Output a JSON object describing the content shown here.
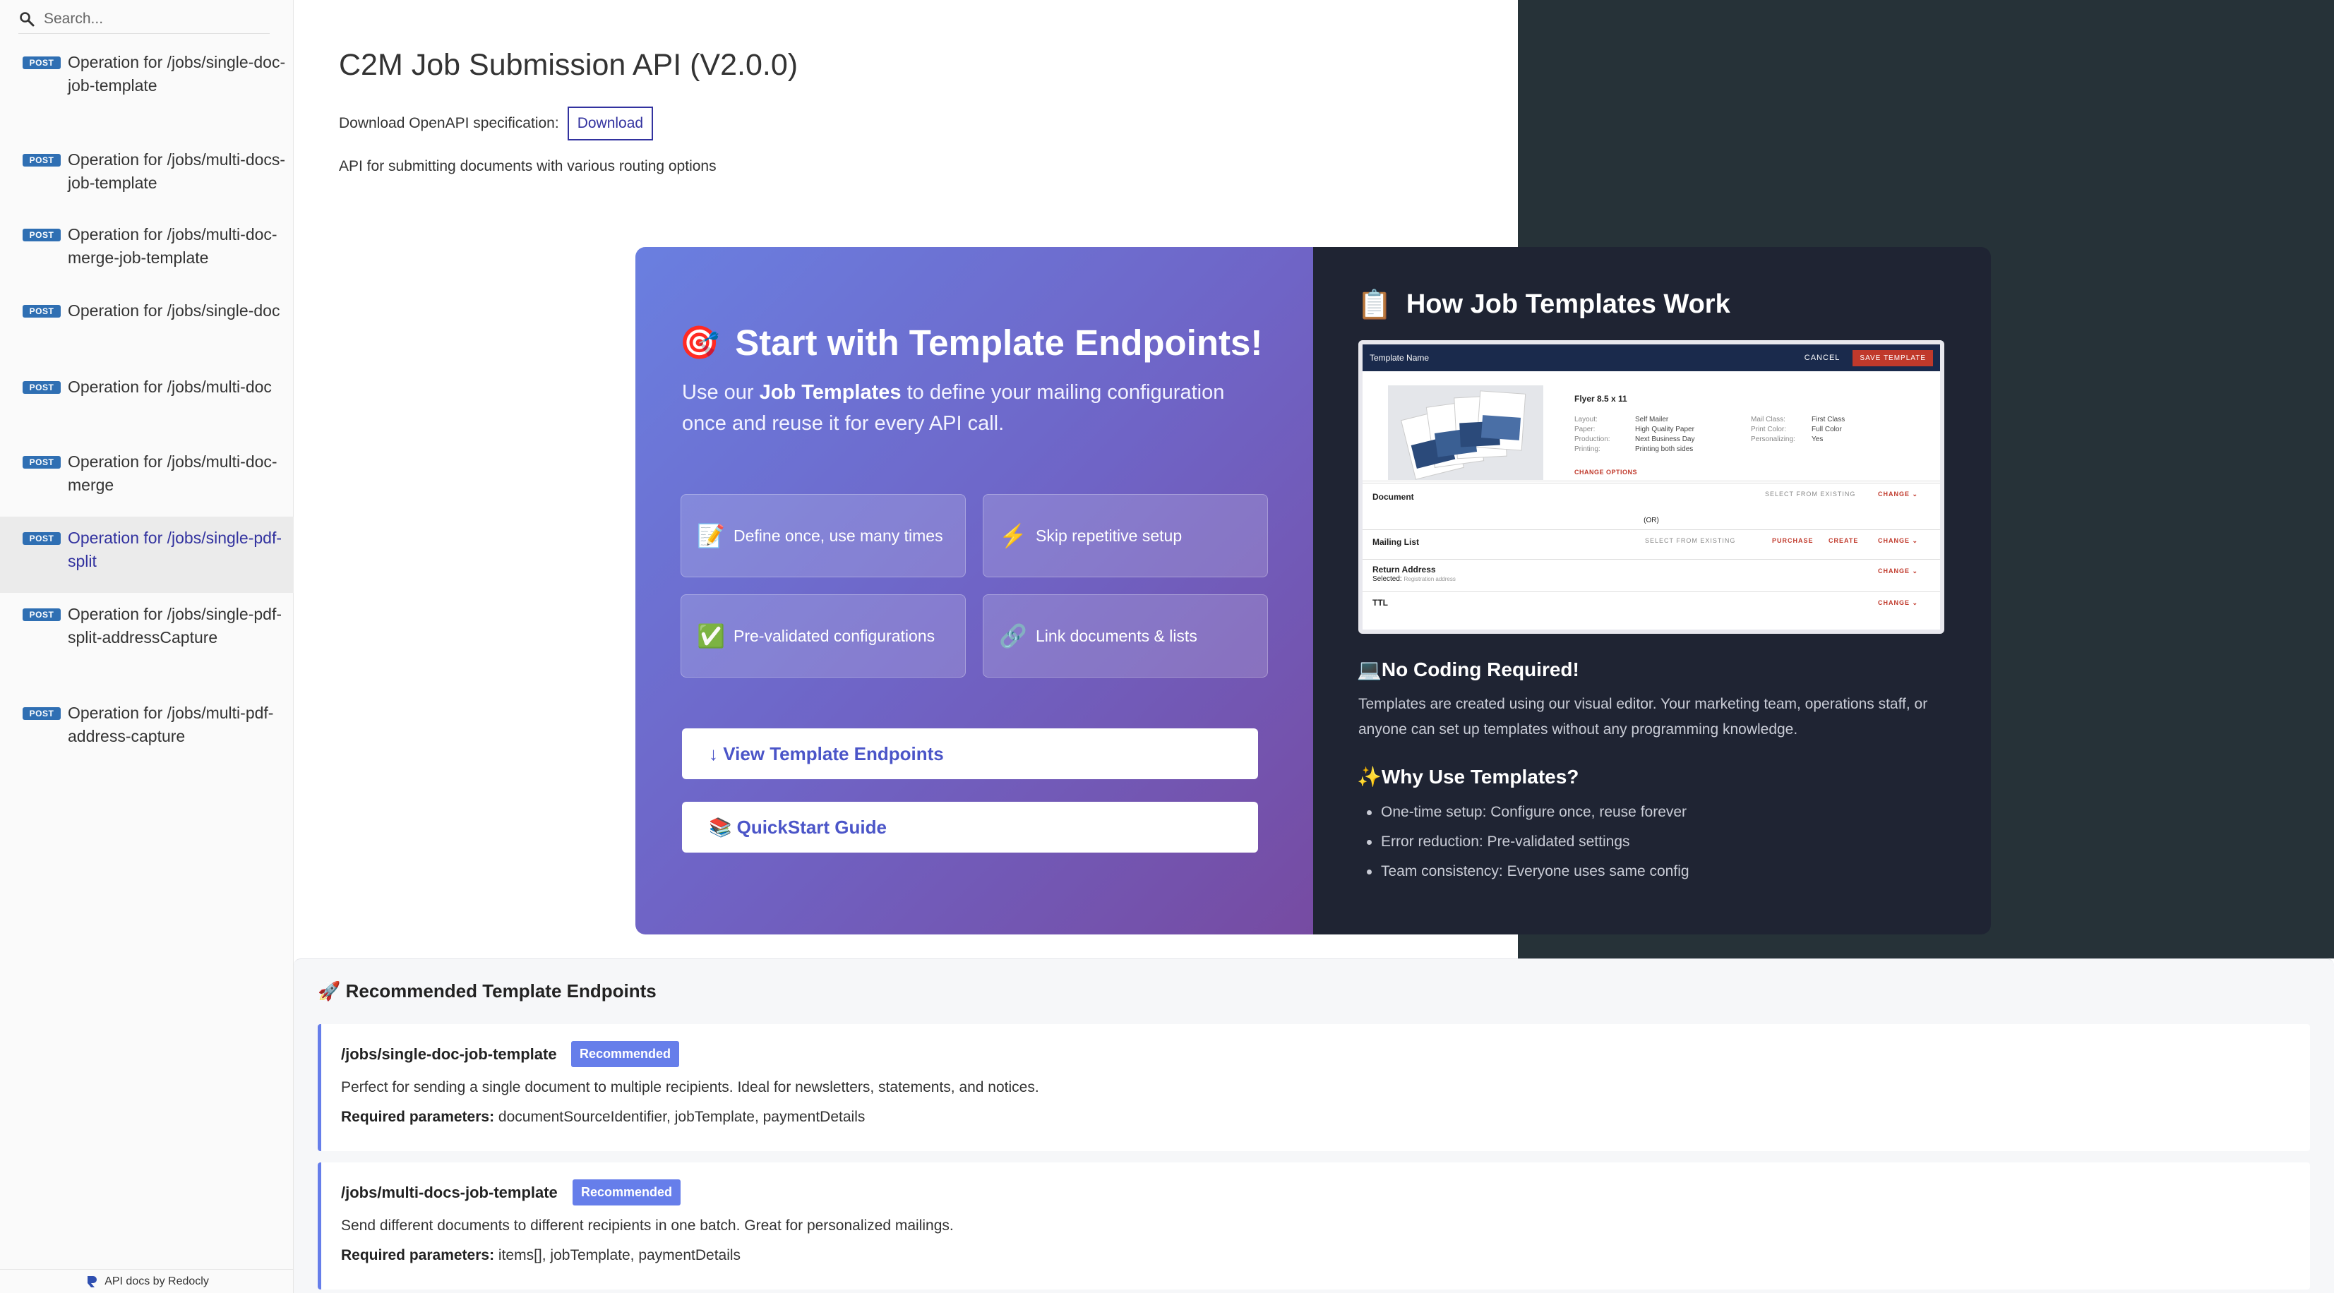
{
  "sidebar": {
    "search_placeholder": "Search...",
    "items": [
      {
        "method": "POST",
        "label": "Operation for /jobs/single-doc-job-template"
      },
      {
        "method": "POST",
        "label": "Operation for /jobs/multi-docs-job-template"
      },
      {
        "method": "POST",
        "label": "Operation for /jobs/multi-doc-merge-job-template"
      },
      {
        "method": "POST",
        "label": "Operation for /jobs/single-doc"
      },
      {
        "method": "POST",
        "label": "Operation for /jobs/multi-doc"
      },
      {
        "method": "POST",
        "label": "Operation for /jobs/multi-doc-merge"
      },
      {
        "method": "POST",
        "label": "Operation for /jobs/single-pdf-split"
      },
      {
        "method": "POST",
        "label": "Operation for /jobs/single-pdf-split-addressCapture"
      },
      {
        "method": "POST",
        "label": "Operation for /jobs/multi-pdf-address-capture"
      }
    ],
    "active_item": "Operation for /jobs/single-pdf-split",
    "footer": "API docs by Redocly"
  },
  "header": {
    "title": "C2M Job Submission API (V2.0.0)",
    "download_label": "Download OpenAPI specification:",
    "download_button": "Download",
    "description": "API for submitting documents with various routing options"
  },
  "hero": {
    "icon": "🎯",
    "title": "Start with Template Endpoints!",
    "intro_pre": "Use our ",
    "intro_bold": "Job Templates",
    "intro_post": " to define your mailing configuration once and reuse it for every API call.",
    "features": [
      {
        "icon": "📝",
        "text": "Define once, use many times"
      },
      {
        "icon": "⚡",
        "text": "Skip repetitive setup"
      },
      {
        "icon": "✅",
        "text": "Pre-validated configurations"
      },
      {
        "icon": "🔗",
        "text": "Link documents & lists"
      }
    ],
    "button_view": "↓ View Template Endpoints",
    "button_quickstart": "📚 QuickStart Guide"
  },
  "how": {
    "icon": "📋",
    "title": "How Job Templates Work",
    "mock": {
      "template_name": "Template Name",
      "cancel": "CANCEL",
      "save": "SAVE TEMPLATE",
      "product": "Flyer 8.5 x 11",
      "specs_left": [
        {
          "k": "Layout:",
          "v": "Self Mailer"
        },
        {
          "k": "Paper:",
          "v": "High Quality Paper"
        },
        {
          "k": "Production:",
          "v": "Next Business Day"
        },
        {
          "k": "Printing:",
          "v": "Printing both sides"
        }
      ],
      "specs_right": [
        {
          "k": "Mail Class:",
          "v": "First Class"
        },
        {
          "k": "Print Color:",
          "v": "Full Color"
        },
        {
          "k": "Personalizing:",
          "v": "Yes"
        }
      ],
      "change_options": "CHANGE OPTIONS",
      "document": "Document",
      "select_existing": "SELECT FROM EXISTING",
      "change": "CHANGE ⌄",
      "or": "(OR)",
      "mailing_list": "Mailing List",
      "purchase": "PURCHASE",
      "create": "CREATE",
      "return_address": "Return Address",
      "selected": "Selected:",
      "selected_value": "Registration address",
      "ttl": "TTL"
    },
    "no_coding_title": "💻No Coding Required!",
    "no_coding_text": "Templates are created using our visual editor. Your marketing team, operations staff, or anyone can set up templates without any programming knowledge.",
    "why_title": "✨Why Use Templates?",
    "benefits": [
      "One-time setup: Configure once, reuse forever",
      "Error reduction: Pre-validated settings",
      "Team consistency: Everyone uses same config"
    ]
  },
  "recommended": {
    "title": "🚀 Recommended Template Endpoints",
    "required_label": "Required parameters:",
    "cards": [
      {
        "path": "/jobs/single-doc-job-template",
        "badge": "Recommended",
        "description": "Perfect for sending a single document to multiple recipients. Ideal for newsletters, statements, and notices.",
        "params": " documentSourceIdentifier, jobTemplate, paymentDetails"
      },
      {
        "path": "/jobs/multi-docs-job-template",
        "badge": "Recommended",
        "description": "Send different documents to different recipients in one batch. Great for personalized mailings.",
        "params": " items[], jobTemplate, paymentDetails"
      }
    ]
  },
  "colors": {
    "badge_post": "#2f6fb3",
    "accent": "#667eea",
    "hero_gradient_end": "#764ba2",
    "dark_panel": "#1f2433",
    "right_panel": "#263238",
    "link_active": "#32329f"
  }
}
